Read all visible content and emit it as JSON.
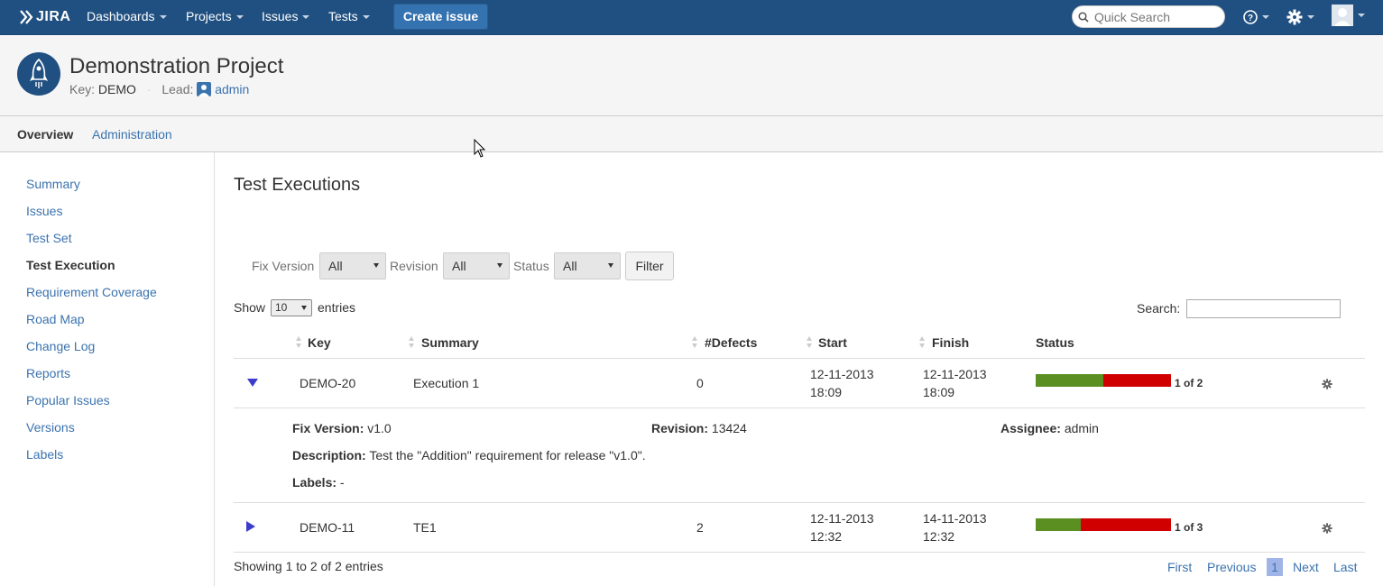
{
  "topbar": {
    "logo": "JIRA",
    "nav": [
      "Dashboards",
      "Projects",
      "Issues",
      "Tests"
    ],
    "create_label": "Create issue",
    "search_placeholder": "Quick Search",
    "icons": [
      "help-icon",
      "gear-icon",
      "user-avatar-icon"
    ]
  },
  "project": {
    "title": "Demonstration Project",
    "key_label": "Key:",
    "key": "DEMO",
    "lead_label": "Lead:",
    "lead": "admin"
  },
  "tabs": {
    "overview": "Overview",
    "administration": "Administration"
  },
  "sidebar": {
    "items": [
      "Summary",
      "Issues",
      "Test Set",
      "Test Execution",
      "Requirement Coverage",
      "Road Map",
      "Change Log",
      "Reports",
      "Popular Issues",
      "Versions",
      "Labels"
    ],
    "active": "Test Execution"
  },
  "main": {
    "heading": "Test Executions",
    "filters": {
      "fix_version_label": "Fix Version",
      "fix_version_value": "All",
      "revision_label": "Revision",
      "revision_value": "All",
      "status_label": "Status",
      "status_value": "All",
      "button": "Filter"
    },
    "show_label": "Show",
    "show_value": "10",
    "entries_label": "entries",
    "search_label": "Search:",
    "columns": [
      "Key",
      "Summary",
      "#Defects",
      "Start",
      "Finish",
      "Status"
    ],
    "rows": [
      {
        "key": "DEMO-20",
        "summary": "Execution 1",
        "defects": "0",
        "start_date": "12-11-2013",
        "start_time": "18:09",
        "finish_date": "12-11-2013",
        "finish_time": "18:09",
        "status_label": "1 of 2",
        "pass_fraction": 0.5,
        "expanded": true
      },
      {
        "key": "DEMO-11",
        "summary": "TE1",
        "defects": "2",
        "start_date": "12-11-2013",
        "start_time": "12:32",
        "finish_date": "14-11-2013",
        "finish_time": "12:32",
        "status_label": "1 of 3",
        "pass_fraction": 0.333,
        "expanded": false
      }
    ],
    "details": {
      "fix_version_label": "Fix Version:",
      "fix_version": "v1.0",
      "revision_label": "Revision:",
      "revision": "13424",
      "assignee_label": "Assignee:",
      "assignee": "admin",
      "description_label": "Description:",
      "description": "Test the \"Addition\" requirement for release \"v1.0\".",
      "labels_label": "Labels:",
      "labels": "-"
    },
    "showing": "Showing 1 to 2 of 2 entries",
    "pagination": {
      "first": "First",
      "previous": "Previous",
      "current": "1",
      "next": "Next",
      "last": "Last"
    }
  },
  "colors": {
    "topbar": "#205081",
    "link": "#3b73af",
    "pass": "#5b8f22",
    "fail": "#d10000"
  }
}
